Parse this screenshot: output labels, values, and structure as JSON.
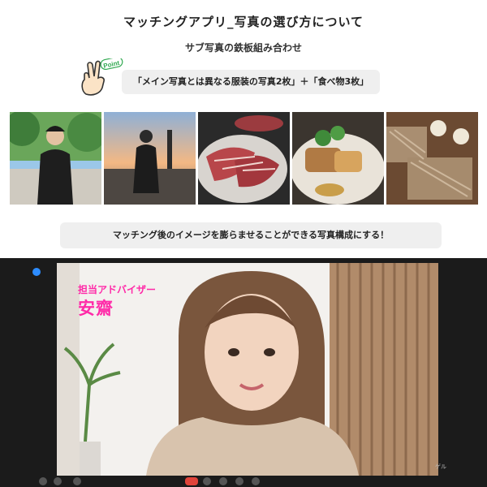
{
  "slide": {
    "title": "マッチングアプリ_写真の選び方について",
    "subtitle": "サブ写真の鉄板組み合わせ",
    "point_badge": "Point",
    "formula": "「メイン写真とは異なる服装の写真2枚」＋「食べ物3枚」",
    "photos": [
      {
        "icon": "man-outdoor-photo"
      },
      {
        "icon": "man-sunset-beach-photo"
      },
      {
        "icon": "yakiniku-meat-photo"
      },
      {
        "icon": "fish-dish-photo"
      },
      {
        "icon": "soba-noodles-photo"
      }
    ],
    "cta": "マッチング後のイメージを膨らませることができる写真構成にする！"
  },
  "call": {
    "advisor_role": "担当アドバイザー",
    "advisor_name": "安齋",
    "right_label": "ゲル",
    "accent_color": "#ff2aa8"
  }
}
